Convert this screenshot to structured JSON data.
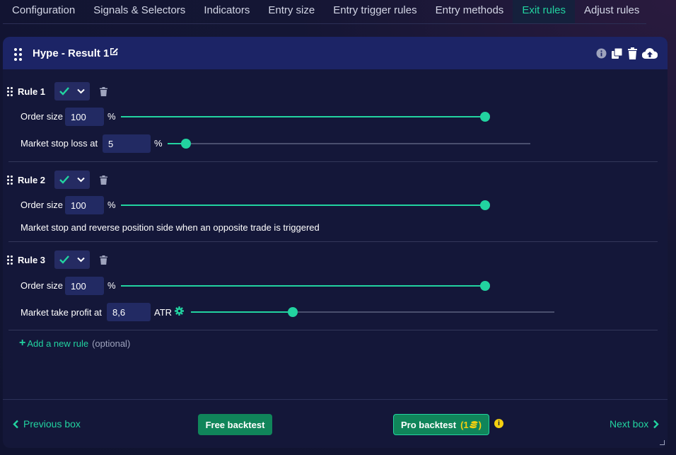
{
  "tabs": [
    {
      "label": "Configuration",
      "active": false
    },
    {
      "label": "Signals & Selectors",
      "active": false
    },
    {
      "label": "Indicators",
      "active": false
    },
    {
      "label": "Entry size",
      "active": false
    },
    {
      "label": "Entry trigger rules",
      "active": false
    },
    {
      "label": "Entry methods",
      "active": false
    },
    {
      "label": "Exit rules",
      "active": true
    },
    {
      "label": "Adjust rules",
      "active": false
    }
  ],
  "panel": {
    "title": "Hype - Result 1",
    "header_icons": [
      "info-icon",
      "copy-icon",
      "trash-icon",
      "cloud-upload-icon"
    ]
  },
  "rules": [
    {
      "label": "Rule 1",
      "fields": [
        {
          "label": "Order size",
          "value": "100",
          "unit": "%",
          "slider_fraction": 1.0
        },
        {
          "label": "Market stop loss at",
          "value": "5",
          "unit": "%",
          "slider_fraction": 0.05
        }
      ]
    },
    {
      "label": "Rule 2",
      "fields": [
        {
          "label": "Order size",
          "value": "100",
          "unit": "%",
          "slider_fraction": 1.0
        }
      ],
      "note": "Market stop and reverse position side when an opposite trade is triggered"
    },
    {
      "label": "Rule 3",
      "fields": [
        {
          "label": "Order size",
          "value": "100",
          "unit": "%",
          "slider_fraction": 1.0
        },
        {
          "label": "Market take profit at",
          "value": "8,6",
          "unit": "ATR",
          "slider_fraction": 0.28
        }
      ]
    }
  ],
  "add_rule": {
    "label": "Add a new rule",
    "optional": "(optional)"
  },
  "footer": {
    "previous": "Previous box",
    "free_backtest": "Free backtest",
    "pro_backtest": "Pro backtest",
    "pro_cost": "1",
    "next": "Next box"
  },
  "colors": {
    "accent": "#22d3a0",
    "button": "#10855a",
    "header": "#1c2466",
    "panel": "#141739",
    "coin": "#f5d010"
  }
}
